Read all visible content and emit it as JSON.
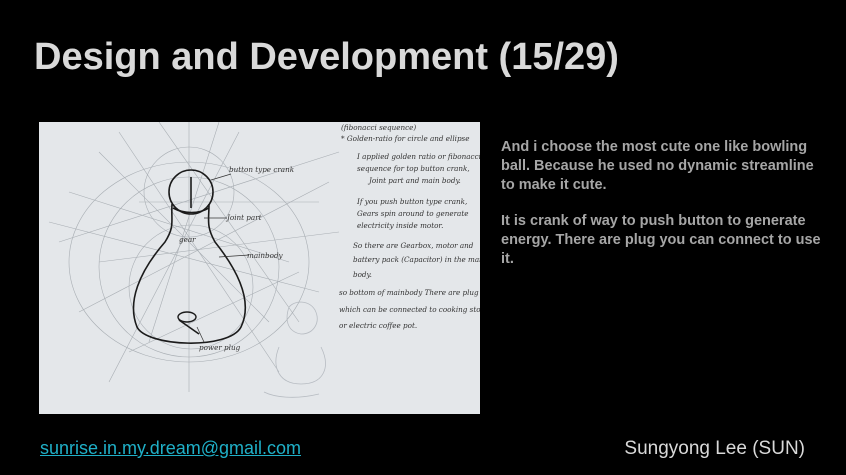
{
  "slide": {
    "title": "Design and Development (15/29)",
    "paragraphs": [
      "And i choose the most cute one like bowling ball. Because he used no dynamic streamline to make it cute.",
      "It is crank of way to push button to generate energy. There are plug you can connect to use it."
    ],
    "footer": {
      "email": "sunrise.in.my.dream@gmail.com",
      "author": "Sungyong Lee (SUN)"
    }
  },
  "sketch_notes": {
    "n1": "(fibonacci sequence)",
    "n2": "* Golden-ratio for circle and ellipse",
    "n3": "I applied golden ratio or fibonacci",
    "n4": "sequence for top button crank,",
    "n5": "Joint part and main body.",
    "n6": "If you push button type crank,",
    "n7": "Gears spin around to generate",
    "n8": "electricity inside motor.",
    "n9": "So there are Gearbox, motor and",
    "n10": "battery pack (Capacitor) in the main",
    "n11": "body.",
    "n12": "so bottom of mainbody There are plug",
    "n13": "which can be connected to cooking stove",
    "n14": "or electric coffee pot.",
    "label_button": "button type crank",
    "label_joint": "Joint part",
    "label_main": "mainbody",
    "label_plug": "power plug",
    "label_gear": "gear"
  },
  "colors": {
    "background": "#000000",
    "title": "#d9d9d9",
    "body": "#a6a6a6",
    "link": "#1fb0c8"
  }
}
